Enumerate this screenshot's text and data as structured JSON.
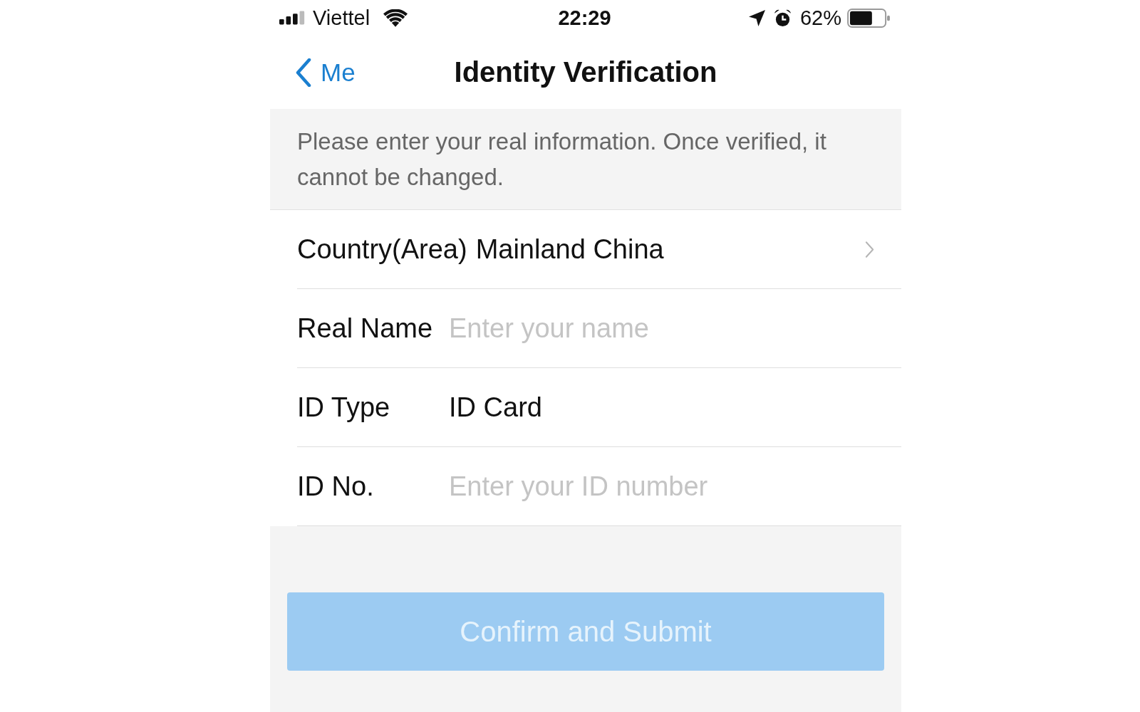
{
  "status_bar": {
    "carrier": "Viettel",
    "time": "22:29",
    "battery_percent": "62%"
  },
  "nav_bar": {
    "back_label": "Me",
    "title": "Identity Verification"
  },
  "notice": "Please enter your real information. Once verified, it cannot be changed.",
  "form_rows": [
    {
      "kind": "select",
      "label": "Country(Area)",
      "value": "Mainland China"
    },
    {
      "kind": "input",
      "label": "Real Name",
      "placeholder": "Enter your name"
    },
    {
      "kind": "static",
      "label": "ID Type",
      "value": "ID Card"
    },
    {
      "kind": "input",
      "label": "ID No.",
      "placeholder": "Enter your ID number"
    }
  ],
  "submit_button": {
    "label": "Confirm and Submit",
    "disabled": true
  }
}
